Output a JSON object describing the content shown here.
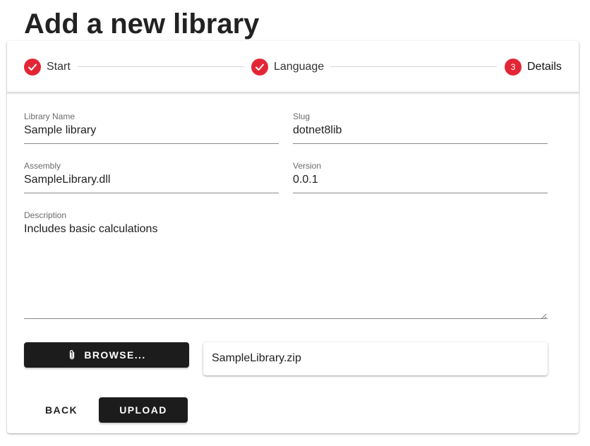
{
  "page": {
    "title": "Add a new library"
  },
  "stepper": {
    "steps": [
      {
        "label": "Start",
        "state": "completed",
        "icon": "check-icon"
      },
      {
        "label": "Language",
        "state": "completed",
        "icon": "check-icon"
      },
      {
        "label": "Details",
        "state": "active",
        "number": "3"
      }
    ],
    "accent_color": "#e32636"
  },
  "form": {
    "library_name": {
      "label": "Library Name",
      "value": "Sample library"
    },
    "slug": {
      "label": "Slug",
      "value": "dotnet8lib"
    },
    "assembly": {
      "label": "Assembly",
      "value": "SampleLibrary.dll"
    },
    "version": {
      "label": "Version",
      "value": "0.0.1"
    },
    "description": {
      "label": "Description",
      "value": "Includes basic calculations"
    }
  },
  "file": {
    "browse_label": "BROWSE...",
    "browse_icon": "paperclip-icon",
    "selected_file": "SampleLibrary.zip"
  },
  "actions": {
    "back_label": "BACK",
    "upload_label": "UPLOAD"
  },
  "colors": {
    "button_dark": "#1c1c1c",
    "text": "#1f1f1f"
  }
}
